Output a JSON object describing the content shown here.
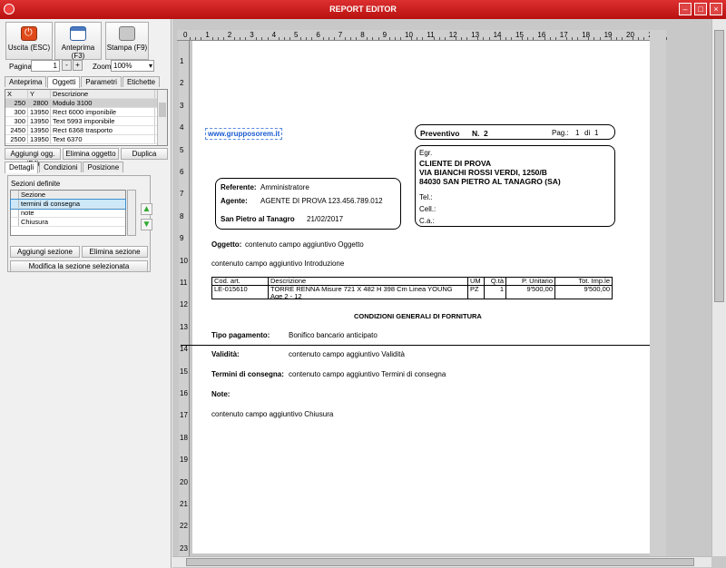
{
  "window": {
    "title": "REPORT EDITOR"
  },
  "toolbar": {
    "exit_label": "Uscita (ESC)",
    "preview_label": "Anteprima (F3)",
    "print_label": "Stampa (F9)"
  },
  "paging": {
    "page_label": "Pagina",
    "page_value": "1",
    "minus": "-",
    "plus": "+",
    "zoom_label": "Zoom",
    "zoom_value": "100%"
  },
  "tabs_main": [
    "Anteprima",
    "Oggetti",
    "Parametri",
    "Etichette"
  ],
  "objects_grid": {
    "headers": [
      "X",
      "Y",
      "Descrizione"
    ],
    "rows": [
      [
        "250",
        "2800",
        "Modulo 3100"
      ],
      [
        "300",
        "13950",
        "Rect 6000 imponibile"
      ],
      [
        "300",
        "13950",
        "Text 5993 imponibile"
      ],
      [
        "2450",
        "13950",
        "Rect 6368 trasporto"
      ],
      [
        "2500",
        "13950",
        "Text 6370"
      ]
    ]
  },
  "object_buttons": {
    "add": "Aggiungi ogg. (F4)",
    "delete": "Elimina oggetto",
    "duplicate": "Duplica"
  },
  "tabs_detail": [
    "Dettagli",
    "Condizioni",
    "Posizione"
  ],
  "sections": {
    "title": "Sezioni definite",
    "header": "Sezione",
    "items": [
      "termini di consegna",
      "note",
      "Chiusura"
    ],
    "add": "Aggiungi sezione",
    "delete": "Elimina sezione",
    "modify": "Modifica la sezione selezionata"
  },
  "ruler_numbers": [
    "0",
    "1",
    "2",
    "3",
    "4",
    "5",
    "6",
    "7",
    "8",
    "9",
    "10",
    "11",
    "12",
    "13",
    "14",
    "15",
    "16",
    "17",
    "18",
    "19",
    "20",
    "21"
  ],
  "ruler_left_numbers": [
    "1",
    "2",
    "3",
    "4",
    "5",
    "6",
    "7",
    "8",
    "9",
    "10",
    "11",
    "12",
    "13",
    "14",
    "15",
    "16",
    "17",
    "18",
    "19",
    "20",
    "21",
    "22",
    "23"
  ],
  "document": {
    "website": "www.grupposorem.it",
    "preventivo_label": "Preventivo",
    "number_label": "N.",
    "number_value": "2",
    "page_label": "Pag.:",
    "page_value": "1",
    "of_label": "di",
    "of_value": "1",
    "egr": "Egr.",
    "client_name": "CLIENTE DI PROVA",
    "client_address": "VIA BIANCHI ROSSI VERDI, 1250/B",
    "client_city": "84030 SAN PIETRO AL TANAGRO (SA)",
    "tel": "Tel.:",
    "cell": "Cell.:",
    "ca": "C.a.:",
    "referente_label": "Referente:",
    "referente_value": "Amministratore",
    "agente_label": "Agente:",
    "agente_value": "AGENTE DI PROVA 123.456.789.012",
    "place": "San Pietro al Tanagro",
    "date": "21/02/2017",
    "oggetto_label": "Oggetto:",
    "oggetto_value": "contenuto campo aggiuntivo Oggetto",
    "intro": "contenuto campo aggiuntivo Introduzione",
    "table_headers": [
      "Cod. art.",
      "Descrizione",
      "UM",
      "Q.tà",
      "P. Unitario",
      "Tot. Imp.le"
    ],
    "table_row": [
      "LE-015610",
      "TORRE RENNA Misure 721 X 482 H 398 Cm Linea YOUNG Age 2 - 12",
      "PZ",
      "1",
      "9'500,00",
      "9'500,00"
    ],
    "conditions_title": "CONDIZIONI GENERALI DI FORNITURA",
    "payment_label": "Tipo pagamento:",
    "payment_value": "Bonifico bancario anticipato",
    "validity_label": "Validità:",
    "validity_value": "contenuto campo aggiuntivo Validità",
    "terms_label": "Termini di consegna:",
    "terms_value": "contenuto campo aggiuntivo Termini di consegna",
    "note_label": "Note:",
    "closing": "contenuto campo aggiuntivo Chiusura"
  }
}
